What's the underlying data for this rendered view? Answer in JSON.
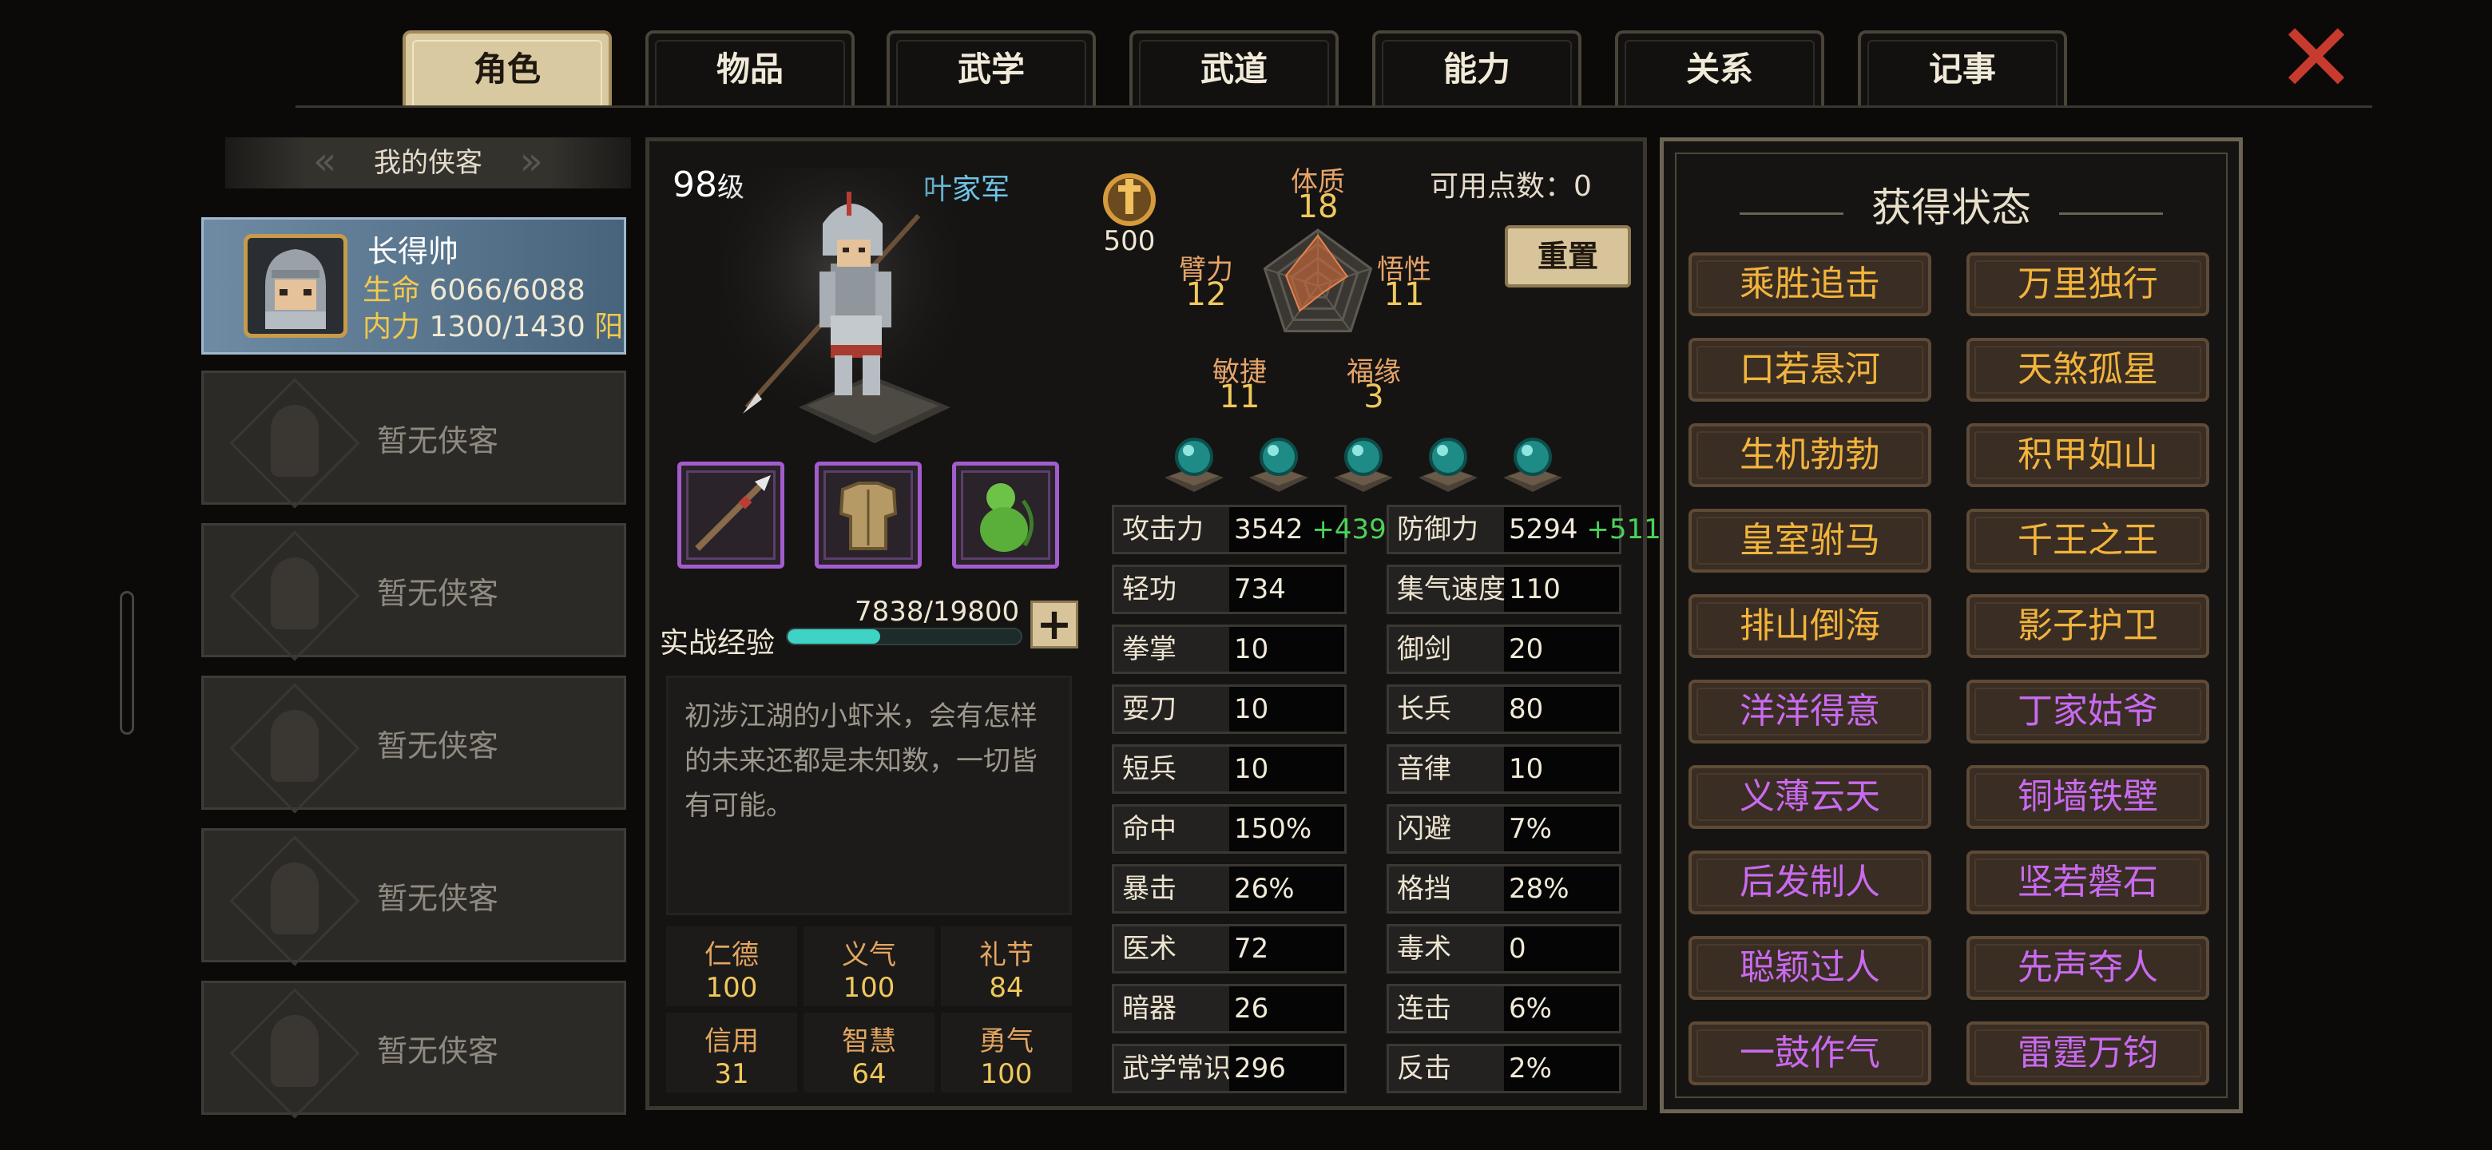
{
  "tabs": [
    {
      "label": "角色",
      "active": true
    },
    {
      "label": "物品",
      "active": false
    },
    {
      "label": "武学",
      "active": false
    },
    {
      "label": "武道",
      "active": false
    },
    {
      "label": "能力",
      "active": false
    },
    {
      "label": "关系",
      "active": false
    },
    {
      "label": "记事",
      "active": false
    }
  ],
  "close_icon": "close-x-icon",
  "party": {
    "title": "我的侠客",
    "selected": {
      "name": "长得帅",
      "hp_label": "生命",
      "hp": "6066/6088",
      "mp_label": "内力",
      "mp": "1300/1430",
      "yin_yang": "阳"
    },
    "empty_label": "暂无侠客",
    "empty_slots": 5
  },
  "character": {
    "level": "98",
    "level_unit": "级",
    "sect": "叶家军",
    "medal_value": "500",
    "available_points_label": "可用点数：",
    "available_points": "0",
    "reset_label": "重置",
    "attributes": [
      {
        "label": "体质",
        "value": "18"
      },
      {
        "label": "悟性",
        "value": "11"
      },
      {
        "label": "福缘",
        "value": "3"
      },
      {
        "label": "敏捷",
        "value": "11"
      },
      {
        "label": "臂力",
        "value": "12"
      }
    ],
    "exp_label": "实战经验",
    "exp_value": "7838/19800",
    "exp_fraction": 0.396,
    "description": "初涉江湖的小虾米，会有怎样的未来还都是未知数，一切皆有可能。",
    "virtues": [
      {
        "label": "仁德",
        "value": "100"
      },
      {
        "label": "义气",
        "value": "100"
      },
      {
        "label": "礼节",
        "value": "84"
      },
      {
        "label": "信用",
        "value": "31"
      },
      {
        "label": "智慧",
        "value": "64"
      },
      {
        "label": "勇气",
        "value": "100"
      }
    ],
    "stats_left": [
      {
        "label": "攻击力",
        "value": "3542",
        "bonus": "+439"
      },
      {
        "label": "轻功",
        "value": "734",
        "bonus": ""
      },
      {
        "label": "拳掌",
        "value": "10",
        "bonus": ""
      },
      {
        "label": "耍刀",
        "value": "10",
        "bonus": ""
      },
      {
        "label": "短兵",
        "value": "10",
        "bonus": ""
      },
      {
        "label": "命中",
        "value": "150%",
        "bonus": ""
      },
      {
        "label": "暴击",
        "value": "26%",
        "bonus": ""
      },
      {
        "label": "医术",
        "value": "72",
        "bonus": ""
      },
      {
        "label": "暗器",
        "value": "26",
        "bonus": ""
      },
      {
        "label": "武学常识",
        "value": "296",
        "bonus": ""
      }
    ],
    "stats_right": [
      {
        "label": "防御力",
        "value": "5294",
        "bonus": "+511"
      },
      {
        "label": "集气速度",
        "value": "110",
        "bonus": ""
      },
      {
        "label": "御剑",
        "value": "20",
        "bonus": ""
      },
      {
        "label": "长兵",
        "value": "80",
        "bonus": ""
      },
      {
        "label": "音律",
        "value": "10",
        "bonus": ""
      },
      {
        "label": "闪避",
        "value": "7%",
        "bonus": ""
      },
      {
        "label": "格挡",
        "value": "28%",
        "bonus": ""
      },
      {
        "label": "毒术",
        "value": "0",
        "bonus": ""
      },
      {
        "label": "连击",
        "value": "6%",
        "bonus": ""
      },
      {
        "label": "反击",
        "value": "2%",
        "bonus": ""
      }
    ]
  },
  "status_panel": {
    "title": "获得状态",
    "items": [
      {
        "label": "乘胜追击",
        "color": "#f2b43c"
      },
      {
        "label": "万里独行",
        "color": "#f2b43c"
      },
      {
        "label": "口若悬河",
        "color": "#f2b43c"
      },
      {
        "label": "天煞孤星",
        "color": "#f2b43c"
      },
      {
        "label": "生机勃勃",
        "color": "#f2b43c"
      },
      {
        "label": "积甲如山",
        "color": "#f2b43c"
      },
      {
        "label": "皇室驸马",
        "color": "#f2b43c"
      },
      {
        "label": "千王之王",
        "color": "#f2b43c"
      },
      {
        "label": "排山倒海",
        "color": "#f2b43c"
      },
      {
        "label": "影子护卫",
        "color": "#f2b43c"
      },
      {
        "label": "洋洋得意",
        "color": "#c96af0"
      },
      {
        "label": "丁家姑爷",
        "color": "#c96af0"
      },
      {
        "label": "义薄云天",
        "color": "#c96af0"
      },
      {
        "label": "铜墙铁壁",
        "color": "#c96af0"
      },
      {
        "label": "后发制人",
        "color": "#c96af0"
      },
      {
        "label": "坚若磐石",
        "color": "#c96af0"
      },
      {
        "label": "聪颖过人",
        "color": "#c96af0"
      },
      {
        "label": "先声夺人",
        "color": "#c96af0"
      },
      {
        "label": "一鼓作气",
        "color": "#c96af0"
      },
      {
        "label": "雷霆万钧",
        "color": "#c96af0"
      }
    ]
  },
  "colors": {
    "accent_gold": "#f0c85c",
    "bonus_green": "#4cd15a",
    "sect_blue": "#6ec4e6",
    "rare_purple": "#c96af0"
  }
}
